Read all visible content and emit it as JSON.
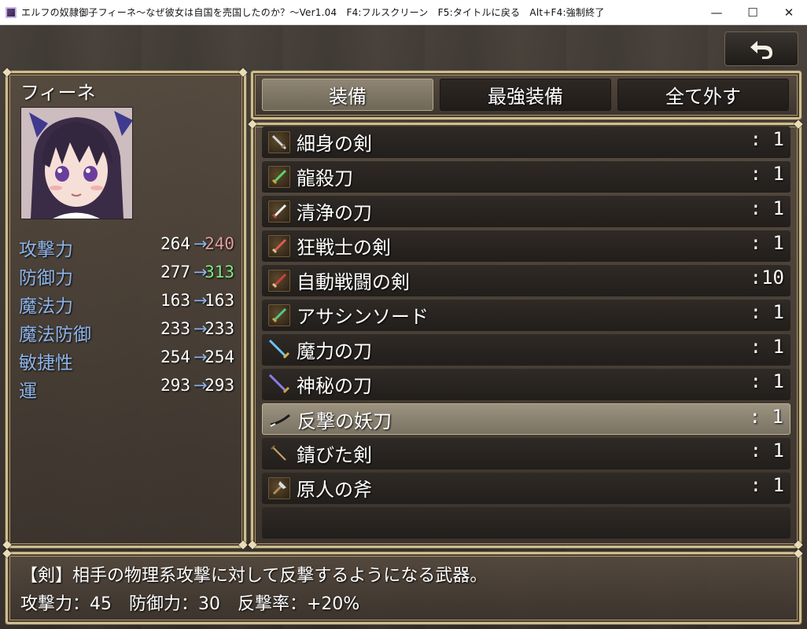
{
  "window": {
    "title": "エルフの奴隷御子フィーネ～なぜ彼女は自国を売国したのか？～Ver1.04　F4:フルスクリーン　F5:タイトルに戻る　Alt+F4:強制終了",
    "minimize": "—",
    "maximize": "☐",
    "close": "✕"
  },
  "actor": {
    "name": "フィーネ",
    "stats": [
      {
        "label": "攻撃力",
        "current": "264",
        "arrow": "→",
        "new": "240",
        "change": "down"
      },
      {
        "label": "防御力",
        "current": "277",
        "arrow": "→",
        "new": "313",
        "change": "up"
      },
      {
        "label": "魔法力",
        "current": "163",
        "arrow": "→",
        "new": "163",
        "change": "same"
      },
      {
        "label": "魔法防御",
        "current": "233",
        "arrow": "→",
        "new": "233",
        "change": "same"
      },
      {
        "label": "敏捷性",
        "current": "254",
        "arrow": "→",
        "new": "254",
        "change": "same"
      },
      {
        "label": "運",
        "current": "293",
        "arrow": "→",
        "new": "293",
        "change": "same"
      }
    ]
  },
  "commands": [
    "装備",
    "最強装備",
    "全て外す"
  ],
  "items": [
    {
      "name": "細身の剣",
      "count": ": 1",
      "icon": "rapier-icon"
    },
    {
      "name": "龍殺刀",
      "count": ": 1",
      "icon": "green-sword-icon"
    },
    {
      "name": "清浄の刀",
      "count": ": 1",
      "icon": "white-sword-icon"
    },
    {
      "name": "狂戦士の剣",
      "count": ": 1",
      "icon": "red-sword-icon"
    },
    {
      "name": "自動戦闘の剣",
      "count": ":10",
      "icon": "red-sword-icon"
    },
    {
      "name": "アサシンソード",
      "count": ": 1",
      "icon": "green-sword-icon"
    },
    {
      "name": "魔力の刀",
      "count": ": 1",
      "icon": "blue-blade-icon"
    },
    {
      "name": "神秘の刀",
      "count": ": 1",
      "icon": "purple-blade-icon"
    },
    {
      "name": "反撃の妖刀",
      "count": ": 1",
      "icon": "katana-icon"
    },
    {
      "name": "錆びた剣",
      "count": ": 1",
      "icon": "rusty-sword-icon"
    },
    {
      "name": "原人の斧",
      "count": ": 1",
      "icon": "axe-icon"
    }
  ],
  "selected_index": 8,
  "help": {
    "line1": "【剣】相手の物理系攻撃に対して反撃するようになる武器。",
    "line2": "攻撃力：45　防御力：30　反撃率：+20%"
  }
}
